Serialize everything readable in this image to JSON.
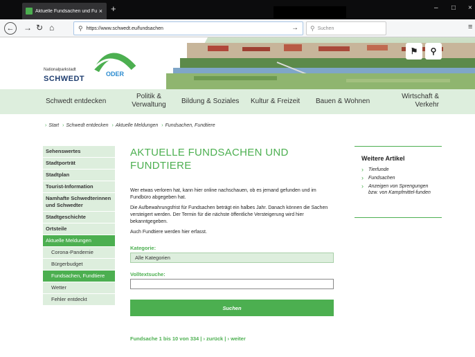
{
  "browser": {
    "tab_title": "Aktuelle Fundsachen und Fund",
    "tab_close": "×",
    "new_tab": "+",
    "url": "https://www.schwedt.eu/fundsachen",
    "search_placeholder": "Suchen",
    "min": "–",
    "max": "□",
    "close": "×"
  },
  "logo": {
    "line1": "Nationalparkstadt",
    "line2": "SCHWEDT",
    "oder": "ODER"
  },
  "nav": {
    "items": [
      "Schwedt entdecken",
      "Politik &\nVerwaltung",
      "Bildung & Soziales",
      "Kultur & Freizeit",
      "Bauen & Wohnen",
      "Wirtschaft &\nVerkehr"
    ]
  },
  "breadcrumb": [
    "Start",
    "Schwedt entdecken",
    "Aktuelle Meldungen",
    "Fundsachen, Fundtiere"
  ],
  "sidebar": {
    "items": [
      "Sehenswertes",
      "Stadtporträt",
      "Stadtplan",
      "Tourist-Information",
      "Namhafte Schwedterinnen und Schwedter",
      "Stadtgeschichte",
      "Ortsteile",
      "Aktuelle Meldungen",
      "Corona-Pandemie",
      "Bürgerbudget",
      "Fundsachen, Fundtiere",
      "Wetter",
      "Fehler entdeckt"
    ]
  },
  "content": {
    "title": "AKTUELLE FUNDSACHEN UND FUNDTIERE",
    "p1": "Wer etwas verloren hat, kann hier online nachschauen, ob es jemand gefunden und im Fundbüro abgegeben hat.",
    "p2": "Die Aufbewahrungsfrist für Fundsachen beträgt ein halbes Jahr. Danach können die Sachen versteigert werden. Der Termin für die nächste öffentliche Versteigerung wird hier bekanntgegeben.",
    "p3": "Auch Fundtiere werden hier erfasst.",
    "category_label": "Kategorie:",
    "category_value": "Alle Kategorien",
    "fulltext_label": "Volltextsuche:",
    "search_button": "Suchen",
    "pager": "Fundsache 1 bis 10 von 334 |  ›  zurück  |  ›  weiter"
  },
  "aside": {
    "title": "Weitere Artikel",
    "items": [
      "Tierfunde",
      "Fundsachen",
      "Anzeigen von Sprengungen bzw. von Kampfmittel-funden"
    ]
  },
  "colors": {
    "accent": "#4caf50",
    "nav_bg": "#ddeedd",
    "logo_blue": "#1e3d6f"
  }
}
